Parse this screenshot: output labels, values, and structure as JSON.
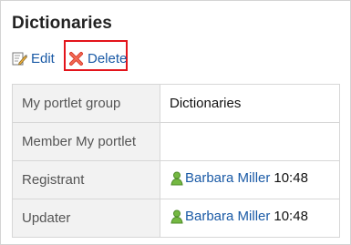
{
  "page": {
    "title": "Dictionaries"
  },
  "toolbar": {
    "edit_label": "Edit",
    "delete_label": "Delete",
    "edit_icon": "edit-icon",
    "delete_icon": "delete-icon"
  },
  "details": {
    "rows": [
      {
        "label": "My portlet group",
        "value": "Dictionaries"
      },
      {
        "label": "Member My portlet",
        "value": ""
      },
      {
        "label": "Registrant",
        "user": "Barbara Miller",
        "time": "10:48",
        "icon": "user-icon"
      },
      {
        "label": "Updater",
        "user": "Barbara Miller",
        "time": "10:48",
        "icon": "user-icon"
      }
    ]
  },
  "colors": {
    "link": "#1a5aa6",
    "highlight": "#e3141b",
    "label_background": "#f2f2f2",
    "border": "#d7d7d7",
    "user_icon": "#74b842",
    "delete_icon": "#d93a2b"
  }
}
